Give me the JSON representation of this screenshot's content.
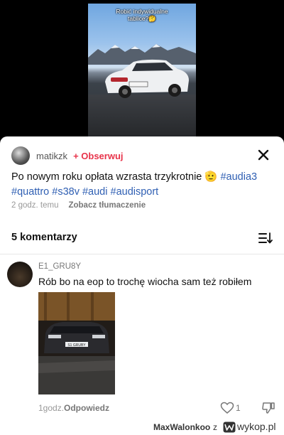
{
  "video": {
    "overlay_text_line1": "Robić indywidualne",
    "overlay_text_line2": "tablice?🤔"
  },
  "post": {
    "username": "matikzk",
    "follow_label": "+ Obserwuj",
    "caption_text": "Po nowym roku opłata wzrasta trzykrotnie 🫡 ",
    "hashtags": [
      "#audia3",
      "#quattro",
      "#s38v",
      "#audi",
      "#audisport"
    ],
    "time": "2 godz. temu",
    "translate_label": "Zobacz tłumaczenie"
  },
  "comments": {
    "header": "5 komentarzy",
    "items": [
      {
        "username": "E1_GRU8Y",
        "text": "Rób bo na eop to trochę wiocha sam też robiłem",
        "time": "1godz.",
        "reply_label": "Odpowiedz",
        "likes": "1",
        "photo_plate": "S1 GRUBY"
      }
    ]
  },
  "footer": {
    "user": "MaxWalonkoo",
    "z": "z",
    "brand": "wykop.pl"
  },
  "colors": {
    "follow": "#e8334a",
    "hashtag": "#2f5fb3",
    "muted": "#999999"
  },
  "icons": [
    "close-icon",
    "sort-icon",
    "heart-icon",
    "dislike-icon",
    "wykop-logo-icon"
  ]
}
